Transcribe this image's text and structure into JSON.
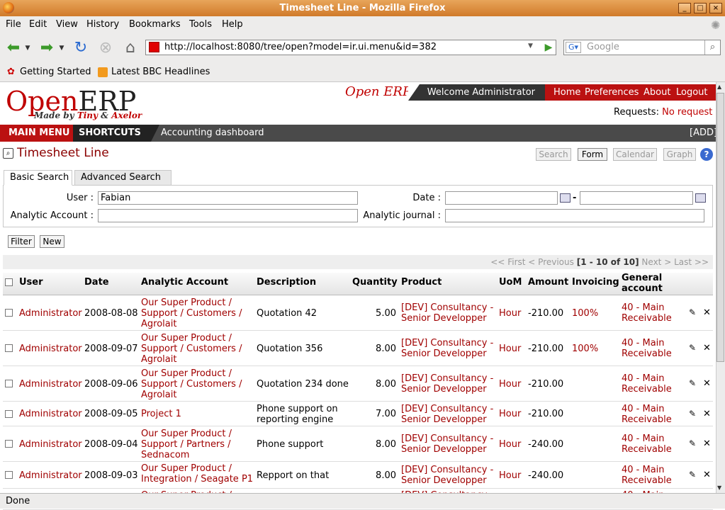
{
  "window": {
    "title": "Timesheet Line - Mozilla Firefox"
  },
  "menu": [
    "File",
    "Edit",
    "View",
    "History",
    "Bookmarks",
    "Tools",
    "Help"
  ],
  "url": "http://localhost:8080/tree/open?model=ir.ui.menu&id=382",
  "search_engine_placeholder": "Google",
  "bookmarks": [
    "Getting Started",
    "Latest BBC Headlines"
  ],
  "app": {
    "logo_open": "Open",
    "logo_erp": "ERP",
    "tagline_pre": "Made by ",
    "tagline_tiny": "Tiny",
    "tagline_mid": " & ",
    "tagline_axelor": "Axelor",
    "small_logo": "Open ERP",
    "welcome": "Welcome Administrator",
    "nav": [
      "Home",
      "Preferences",
      "About",
      "Logout"
    ],
    "requests_label": "Requests:",
    "requests_value": "No request"
  },
  "mainbar": {
    "main_menu": "MAIN MENU",
    "shortcuts": "SHORTCUTS",
    "shortcut_item": "Accounting dashboard",
    "add": "[ADD]"
  },
  "page_title": "Timesheet Line",
  "views": [
    "Search",
    "Form",
    "Calendar",
    "Graph"
  ],
  "tabs": [
    "Basic Search",
    "Advanced Search"
  ],
  "fields": {
    "user_label": "User :",
    "user_value": "Fabian",
    "date_label": "Date :",
    "date_from": "",
    "date_to": "",
    "date_sep": "-",
    "analytic_account_label": "Analytic Account :",
    "analytic_account_value": "",
    "analytic_journal_label": "Analytic journal :",
    "analytic_journal_value": ""
  },
  "buttons": {
    "filter": "Filter",
    "new": "New"
  },
  "pager": {
    "first": "<< First",
    "previous": "< Previous",
    "range": "[1 - 10 of 10]",
    "next": "Next >",
    "last": "Last >>"
  },
  "columns": [
    "User",
    "Date",
    "Analytic Account",
    "Description",
    "Quantity",
    "Product",
    "UoM",
    "Amount",
    "Invoicing",
    "General account"
  ],
  "rows": [
    {
      "user": "Administrator",
      "date": "2008-08-08",
      "account": "Our Super Product / Support / Customers / Agrolait",
      "description": "Quotation 42",
      "quantity": "5.00",
      "product": "[DEV] Consultancy - Senior Developper",
      "uom": "Hour",
      "amount": "-210.00",
      "invoicing": "100%",
      "general": "40 - Main Receivable"
    },
    {
      "user": "Administrator",
      "date": "2008-09-07",
      "account": "Our Super Product / Support / Customers / Agrolait",
      "description": "Quotation 356",
      "quantity": "8.00",
      "product": "[DEV] Consultancy - Senior Developper",
      "uom": "Hour",
      "amount": "-210.00",
      "invoicing": "100%",
      "general": "40 - Main Receivable"
    },
    {
      "user": "Administrator",
      "date": "2008-09-06",
      "account": "Our Super Product / Support / Customers / Agrolait",
      "description": "Quotation 234 done",
      "quantity": "8.00",
      "product": "[DEV] Consultancy - Senior Developper",
      "uom": "Hour",
      "amount": "-210.00",
      "invoicing": "",
      "general": "40 - Main Receivable"
    },
    {
      "user": "Administrator",
      "date": "2008-09-05",
      "account": "Project 1",
      "description": "Phone support on reporting engine",
      "quantity": "7.00",
      "product": "[DEV] Consultancy - Senior Developper",
      "uom": "Hour",
      "amount": "-210.00",
      "invoicing": "",
      "general": "40 - Main Receivable"
    },
    {
      "user": "Administrator",
      "date": "2008-09-04",
      "account": "Our Super Product / Support / Partners / Sednacom",
      "description": "Phone support",
      "quantity": "8.00",
      "product": "[DEV] Consultancy - Senior Developper",
      "uom": "Hour",
      "amount": "-240.00",
      "invoicing": "",
      "general": "40 - Main Receivable"
    },
    {
      "user": "Administrator",
      "date": "2008-09-03",
      "account": "Our Super Product / Integration / Seagate P1",
      "description": "Repport on that",
      "quantity": "8.00",
      "product": "[DEV] Consultancy - Senior Developper",
      "uom": "Hour",
      "amount": "-240.00",
      "invoicing": "",
      "general": "40 - Main Receivable"
    },
    {
      "user": "",
      "date": "",
      "account": "Our Super Product /",
      "description": "",
      "quantity": "",
      "product": "[DEV] Consultancy -",
      "uom": "",
      "amount": "",
      "invoicing": "",
      "general": "40 - Main"
    }
  ],
  "status": "Done"
}
